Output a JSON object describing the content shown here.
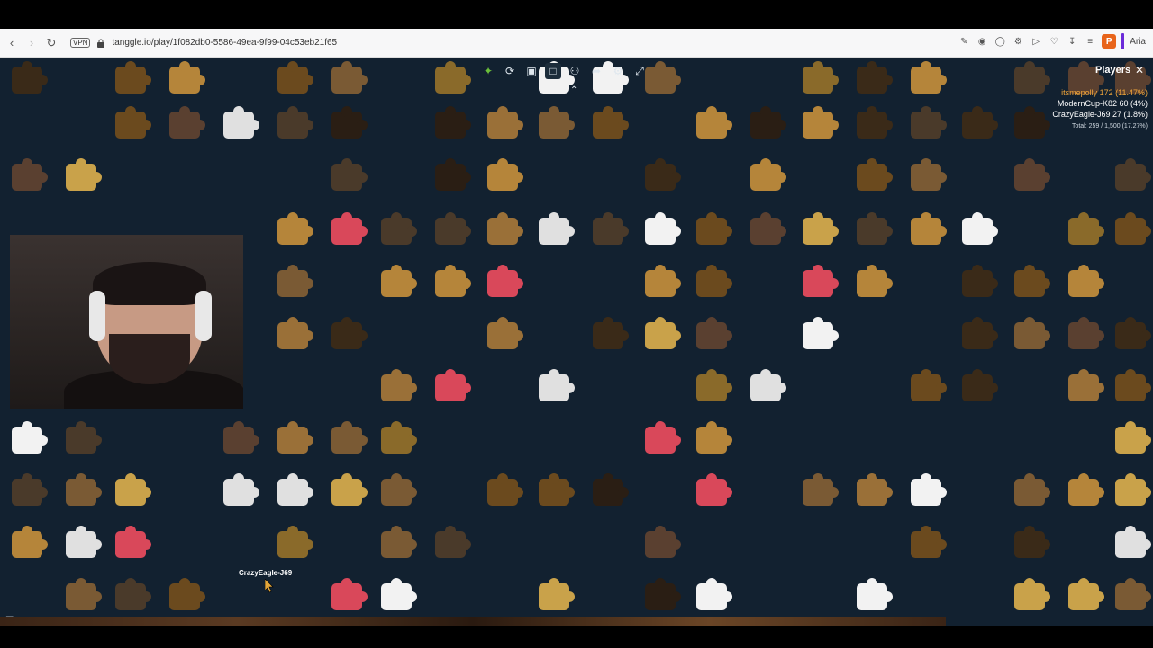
{
  "browser": {
    "url": "tangglе.io/play/1f082db0-5586-49ea-9f99-04c53eb21f65",
    "vpn_label": "VPN",
    "ai_label": "Aria"
  },
  "game": {
    "players_title": "Players",
    "players": [
      {
        "name": "itsmepolly",
        "score": "172 (11.47%)"
      },
      {
        "name": "ModernCup-K82",
        "score": "60 (4%)"
      },
      {
        "name": "CrazyEagle-J69",
        "score": "27 (1.8%)"
      }
    ],
    "total": "Total: 259 / 1,500 (17.27%)",
    "cursor_user": "CrazyEagle-J69"
  },
  "colors": {
    "background": "#122130",
    "highlight": "#f0a53a"
  },
  "icons": {
    "toolbar": [
      "puzzle-icon",
      "rotate-icon",
      "image-icon",
      "box-icon",
      "players-icon",
      "share-icon",
      "settings-icon",
      "fullscreen-icon"
    ],
    "collapse": "chevron-up-icon",
    "close": "close-icon",
    "chat": "chat-icon"
  }
}
